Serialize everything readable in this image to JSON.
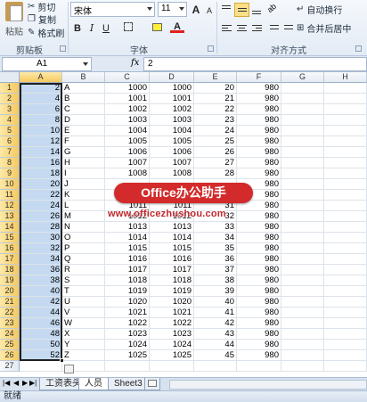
{
  "ribbon": {
    "paste_label": "粘贴",
    "cut_label": "剪切",
    "copy_label": "复制",
    "format_painter_label": "格式刷",
    "clipboard_group": "剪贴板",
    "font_name": "宋体",
    "font_size": "11",
    "bold": "B",
    "italic": "I",
    "underline": "U",
    "font_color_glyph": "A",
    "grow_font_glyph": "A",
    "shrink_font_glyph": "A",
    "font_group": "字体",
    "wrap_text_label": "自动换行",
    "merge_center_label": "合并后居中",
    "alignment_group": "对齐方式"
  },
  "formula_bar": {
    "name_box": "A1",
    "fx": "fx",
    "value": "2"
  },
  "columns": [
    "A",
    "B",
    "C",
    "D",
    "E",
    "F",
    "G",
    "H"
  ],
  "rows": [
    {
      "n": "1",
      "a": "2",
      "b": "A",
      "c": "1000",
      "d": "1000",
      "e": "20",
      "f": "980"
    },
    {
      "n": "2",
      "a": "4",
      "b": "B",
      "c": "1001",
      "d": "1001",
      "e": "21",
      "f": "980"
    },
    {
      "n": "3",
      "a": "6",
      "b": "C",
      "c": "1002",
      "d": "1002",
      "e": "22",
      "f": "980"
    },
    {
      "n": "4",
      "a": "8",
      "b": "D",
      "c": "1003",
      "d": "1003",
      "e": "23",
      "f": "980"
    },
    {
      "n": "5",
      "a": "10",
      "b": "E",
      "c": "1004",
      "d": "1004",
      "e": "24",
      "f": "980"
    },
    {
      "n": "6",
      "a": "12",
      "b": "F",
      "c": "1005",
      "d": "1005",
      "e": "25",
      "f": "980"
    },
    {
      "n": "7",
      "a": "14",
      "b": "G",
      "c": "1006",
      "d": "1006",
      "e": "26",
      "f": "980"
    },
    {
      "n": "8",
      "a": "16",
      "b": "H",
      "c": "1007",
      "d": "1007",
      "e": "27",
      "f": "980"
    },
    {
      "n": "9",
      "a": "18",
      "b": "I",
      "c": "1008",
      "d": "1008",
      "e": "28",
      "f": "980"
    },
    {
      "n": "10",
      "a": "20",
      "b": "J",
      "c": "",
      "d": "",
      "e": "",
      "f": "980"
    },
    {
      "n": "11",
      "a": "22",
      "b": "K",
      "c": "",
      "d": "",
      "e": "",
      "f": "980"
    },
    {
      "n": "12",
      "a": "24",
      "b": "L",
      "c": "1011",
      "d": "1011",
      "e": "31",
      "f": "980"
    },
    {
      "n": "13",
      "a": "26",
      "b": "M",
      "c": "1012",
      "d": "1012",
      "e": "32",
      "f": "980"
    },
    {
      "n": "14",
      "a": "28",
      "b": "N",
      "c": "1013",
      "d": "1013",
      "e": "33",
      "f": "980"
    },
    {
      "n": "15",
      "a": "30",
      "b": "O",
      "c": "1014",
      "d": "1014",
      "e": "34",
      "f": "980"
    },
    {
      "n": "16",
      "a": "32",
      "b": "P",
      "c": "1015",
      "d": "1015",
      "e": "35",
      "f": "980"
    },
    {
      "n": "17",
      "a": "34",
      "b": "Q",
      "c": "1016",
      "d": "1016",
      "e": "36",
      "f": "980"
    },
    {
      "n": "18",
      "a": "36",
      "b": "R",
      "c": "1017",
      "d": "1017",
      "e": "37",
      "f": "980"
    },
    {
      "n": "19",
      "a": "38",
      "b": "S",
      "c": "1018",
      "d": "1018",
      "e": "38",
      "f": "980"
    },
    {
      "n": "20",
      "a": "40",
      "b": "T",
      "c": "1019",
      "d": "1019",
      "e": "39",
      "f": "980"
    },
    {
      "n": "21",
      "a": "42",
      "b": "U",
      "c": "1020",
      "d": "1020",
      "e": "40",
      "f": "980"
    },
    {
      "n": "22",
      "a": "44",
      "b": "V",
      "c": "1021",
      "d": "1021",
      "e": "41",
      "f": "980"
    },
    {
      "n": "23",
      "a": "46",
      "b": "W",
      "c": "1022",
      "d": "1022",
      "e": "42",
      "f": "980"
    },
    {
      "n": "24",
      "a": "48",
      "b": "X",
      "c": "1023",
      "d": "1023",
      "e": "43",
      "f": "980"
    },
    {
      "n": "25",
      "a": "50",
      "b": "Y",
      "c": "1024",
      "d": "1024",
      "e": "44",
      "f": "980"
    },
    {
      "n": "26",
      "a": "52",
      "b": "Z",
      "c": "1025",
      "d": "1025",
      "e": "45",
      "f": "980"
    },
    {
      "n": "27",
      "a": "",
      "b": "",
      "c": "",
      "d": "",
      "e": "",
      "f": ""
    }
  ],
  "watermark": {
    "brand": "Office办公助手",
    "url": "www.officezhushou.com"
  },
  "sheet_tabs": [
    "工资表头",
    "人员",
    "Sheet3"
  ],
  "active_tab": "人员",
  "status": "就绪",
  "colors": {
    "selection_fill": "#c5daf0",
    "header_highlight": "#f6c95e",
    "watermark_red": "#d32b2b"
  }
}
